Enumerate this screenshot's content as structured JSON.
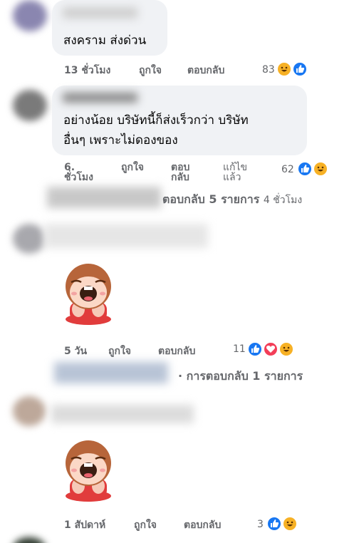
{
  "comments": [
    {
      "text": "สงคราม ส่งด่วน",
      "time": "13 ชั่วโมง",
      "like": "ถูกใจ",
      "reply": "ตอบกลับ",
      "count": "83"
    },
    {
      "text_line1": "อย่างน้อย บริษัทนี้ก็ส่งเร็วกว่า บริษัท",
      "text_line2": "อื่นๆ เพราะไม่ดองของ",
      "time_line1": "6.",
      "time_line2": "ชั่วโมง",
      "like": "ถูกใจ",
      "reply_line1": "ตอบ",
      "reply_line2": "กลับ",
      "edited_line1": "แก้ไข",
      "edited_line2": "แล้ว",
      "count": "62",
      "replies_summary": "ตอบกลับ 5 รายการ",
      "replies_time": "4 ชั่วโมง"
    },
    {
      "time": "5 วัน",
      "like": "ถูกใจ",
      "reply": "ตอบกลับ",
      "count": "11",
      "replies_summary": "· การตอบกลับ 1 รายการ"
    },
    {
      "time": "1 สัปดาห์",
      "like": "ถูกใจ",
      "reply": "ตอบกลับ",
      "count": "3"
    }
  ],
  "colors": {
    "bubble": "#f0f2f5",
    "meta": "#65676b",
    "like": "#1877f2",
    "love": "#f33e58",
    "haha": "#f7b125"
  }
}
